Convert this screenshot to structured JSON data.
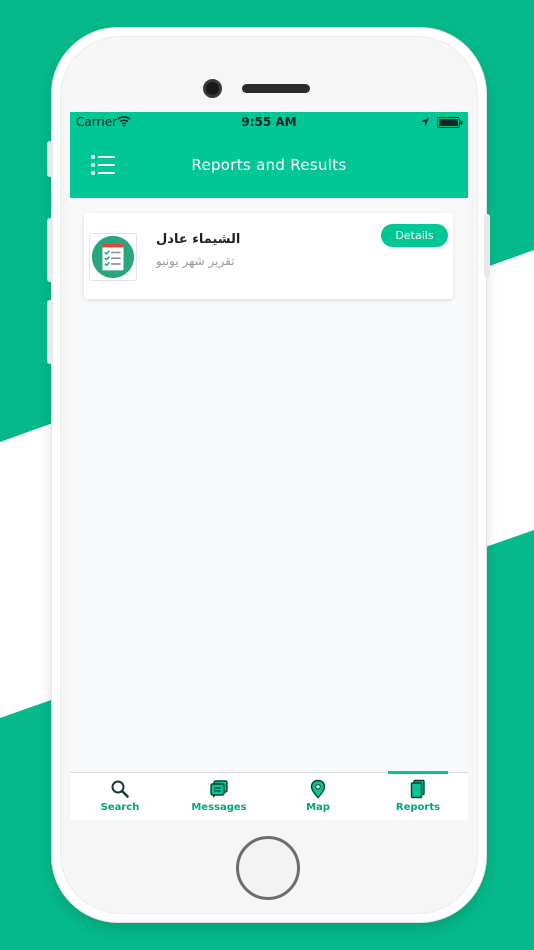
{
  "status": {
    "carrier": "Carrier",
    "time": "9:55 AM"
  },
  "navbar": {
    "title": "Reports and Results",
    "menu_icon": "list-menu-icon"
  },
  "reports": [
    {
      "name": "الشيماء عادل",
      "subtitle": "تقرير شهر يونيو",
      "icon": "checklist-report-icon",
      "details_label": "Details"
    }
  ],
  "tabs": [
    {
      "label": "Search",
      "icon": "search-icon"
    },
    {
      "label": "Messages",
      "icon": "messages-icon"
    },
    {
      "label": "Map",
      "icon": "map-pin-icon"
    },
    {
      "label": "Reports",
      "icon": "reports-icon"
    }
  ],
  "active_tab": "Reports",
  "colors": {
    "brand": "#00c795",
    "background": "#05b98a",
    "tab_label": "#00a77d"
  }
}
